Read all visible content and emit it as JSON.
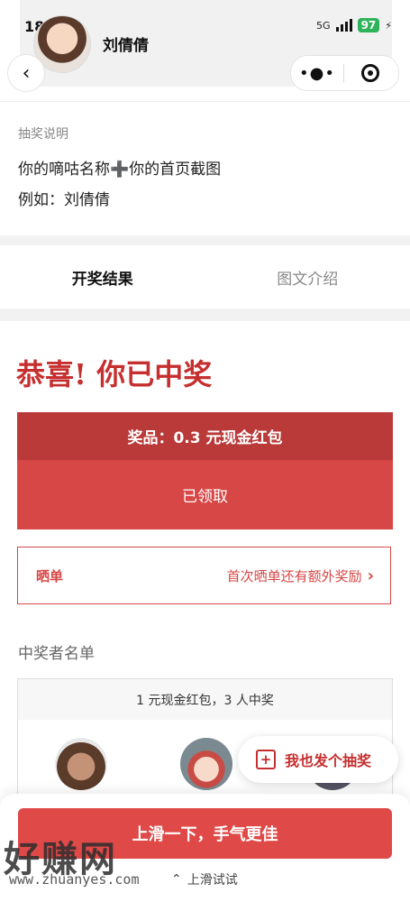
{
  "status_bar": {
    "time": "18:08",
    "network": "5G",
    "battery": "97"
  },
  "header": {
    "user_name": "刘倩倩"
  },
  "description": {
    "label": "抽奖说明",
    "line1": "你的嘀咕名称➕你的首页截图",
    "line2": "例如：刘倩倩"
  },
  "tabs": [
    {
      "label": "开奖结果"
    },
    {
      "label": "图文介绍"
    }
  ],
  "result": {
    "congrats": "恭喜! 你已中奖",
    "prize": "奖品：0.3 元现金红包",
    "claimed": "已领取"
  },
  "share": {
    "label": "晒单",
    "text": "首次晒单还有额外奖励"
  },
  "winners": {
    "title": "中奖者名单",
    "summary": "1 元现金红包，3 人中奖"
  },
  "float_button": {
    "label": "我也发个抽奖"
  },
  "bottom": {
    "swipe_button": "上滑一下，手气更佳",
    "hint": "上滑试试"
  },
  "watermark": {
    "big": "好赚网",
    "small": "www.zhuanyes.com"
  }
}
